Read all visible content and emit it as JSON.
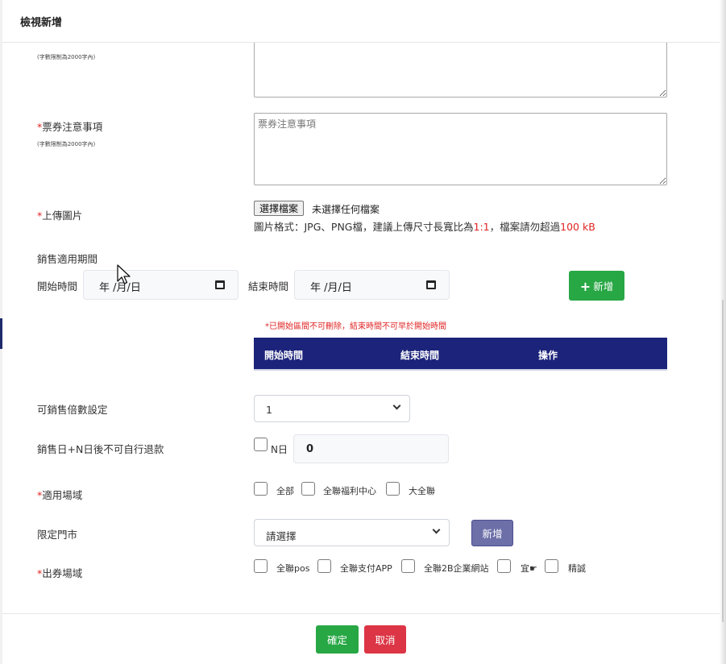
{
  "modal": {
    "title": "檢視新增"
  },
  "form": {
    "top_hint": "(字數限制為2000字內)",
    "ticket_notes": {
      "required_mark": "*",
      "label": "票券注意事項",
      "hint": "(字數限制為2000字內)",
      "placeholder": "票券注意事項"
    },
    "upload_image": {
      "required_mark": "*",
      "label": "上傳圖片",
      "button_label": "選擇檔案",
      "status": "未選擇任何檔案",
      "hint_prefix": "圖片格式：JPG、PNG檔，建議上傳尺寸長寬比為",
      "hint_ratio": "1:1",
      "hint_mid": "，檔案請勿超過",
      "hint_size": "100 kB"
    },
    "sale_period": {
      "label": "銷售適用期間",
      "start_label": "開始時間",
      "start_value": "年 /月/日",
      "end_label": "結束時間",
      "end_value": "年 /月/日",
      "add_label": "新增",
      "warning": "*已開始區間不可刪除，結束時間不可早於開始時間",
      "table_headers": [
        "開始時間",
        "結束時間",
        "操作"
      ]
    },
    "multiplier": {
      "label": "可銷售倍數設定",
      "value": "1"
    },
    "refund": {
      "label": "銷售日+N日後不可自行退款",
      "checkbox_label": "N日",
      "value": "0"
    },
    "venue": {
      "required_mark": "*",
      "label": "適用場域",
      "options": [
        "全部",
        "全聯福利中心",
        "大全聯"
      ]
    },
    "store": {
      "label": "限定門市",
      "placeholder": "請選擇",
      "add_label": "新增"
    },
    "issue_venue": {
      "required_mark": "*",
      "label": "出券場域",
      "options": [
        "全聯pos",
        "全聯支付APP",
        "全聯2B企業網站",
        "宜☛",
        "精誠"
      ]
    }
  },
  "footer": {
    "confirm_label": "確定",
    "cancel_label": "取消"
  },
  "colors": {
    "header_navy": "#1b237a",
    "success_green": "#28a745",
    "danger_red": "#dc3545",
    "required_red": "#e02424",
    "purple_button": "#6c6fa8"
  }
}
